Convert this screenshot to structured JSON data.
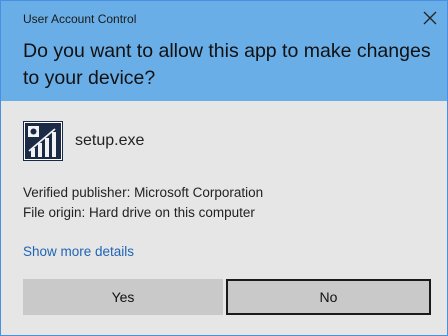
{
  "window": {
    "title": "User Account Control"
  },
  "header": {
    "question": "Do you want to allow this app to make changes to your device?"
  },
  "app": {
    "name": "setup.exe",
    "icon": "setup-chart-icon"
  },
  "details": {
    "publisher": "Verified publisher: Microsoft Corporation",
    "origin": "File origin: Hard drive on this computer",
    "show_more": "Show more details"
  },
  "buttons": {
    "yes": "Yes",
    "no": "No"
  },
  "colors": {
    "header": "#6aaee8",
    "body": "#e6e6e6",
    "link": "#1f64b5",
    "button": "#c9c9c9"
  }
}
